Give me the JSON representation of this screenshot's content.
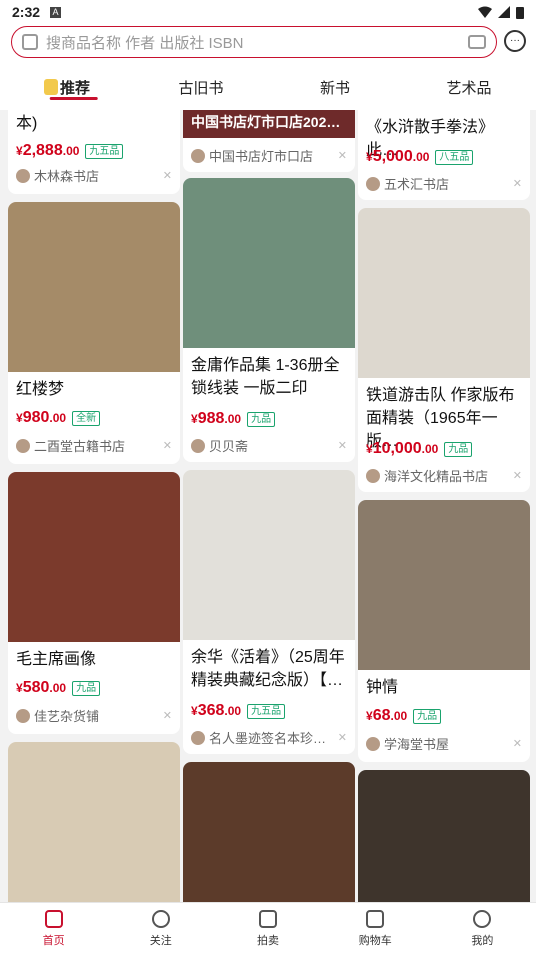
{
  "status": {
    "time": "2:32",
    "a_icon": "A"
  },
  "search": {
    "placeholder": "搜商品名称 作者 出版社 ISBN"
  },
  "tabs": [
    {
      "label": "推荐"
    },
    {
      "label": "古旧书"
    },
    {
      "label": "新书"
    },
    {
      "label": "艺术品"
    }
  ],
  "items": {
    "c1": {
      "title": "本)",
      "cur": "¥",
      "int": "2,888",
      "dec": ".00",
      "cond": "九五品",
      "shop": "木林森书店"
    },
    "c2": {
      "banner": "中国书店灯市口店202…",
      "shop": "中国书店灯市口店"
    },
    "c3": {
      "title": "《水浒散手拳法》此…",
      "cur": "¥",
      "int": "5,000",
      "dec": ".00",
      "cond": "八五品",
      "shop": "五术汇书店"
    },
    "c4": {
      "title": "红楼梦",
      "cur": "¥",
      "int": "980",
      "dec": ".00",
      "cond": "全新",
      "shop": "二酉堂古籍书店"
    },
    "c5": {
      "title": "金庸作品集 1-36册全锁线装 一版二印",
      "cur": "¥",
      "int": "988",
      "dec": ".00",
      "cond": "九品",
      "shop": "贝贝斋"
    },
    "c6": {
      "title": "铁道游击队 作家版布面精装（1965年一版…",
      "cur": "¥",
      "int": "10,000",
      "dec": ".00",
      "cond": "九品",
      "shop": "海洋文化精品书店"
    },
    "c7": {
      "title": "毛主席画像",
      "cur": "¥",
      "int": "580",
      "dec": ".00",
      "cond": "九品",
      "shop": "佳艺杂货铺"
    },
    "c8": {
      "title": "余华《活着》（25周年精装典藏纪念版）【…",
      "cur": "¥",
      "int": "368",
      "dec": ".00",
      "cond": "九五品",
      "shop": "名人墨迹签名本珍…"
    },
    "c9": {
      "title": "钟情",
      "cur": "¥",
      "int": "68",
      "dec": ".00",
      "cond": "九品",
      "shop": "学海堂书屋"
    }
  },
  "nav": [
    {
      "label": "首页"
    },
    {
      "label": "关注"
    },
    {
      "label": "拍卖"
    },
    {
      "label": "购物车"
    },
    {
      "label": "我的"
    }
  ],
  "colors": {
    "accent": "#c8102e",
    "price": "#d0021b",
    "condition": "#1aa36d"
  }
}
